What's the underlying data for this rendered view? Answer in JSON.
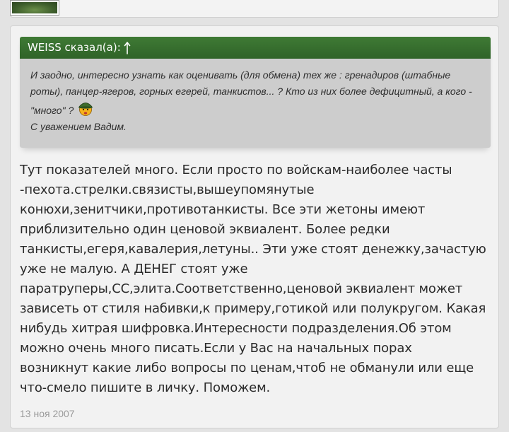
{
  "quote": {
    "author_header": "WEISS сказал(а):",
    "lines": [
      "И заодно, интересно узнать как оценивать (для обмена) тех же : гренадиров (штабные",
      "роты), панцер-ягеров, горных егерей, танкистов... ? Кто из них более дефицитный, а кого -",
      "\"много\" ?",
      "С уважением Вадим."
    ],
    "smiley_icon": "soldier-smiley-icon"
  },
  "message": {
    "lines": [
      "Тут показателей много. Если просто по войскам-наиболее часты",
      "-пехота.стрелки.связисты,вышеупомянутые",
      "конюхи,зенитчики,противотанкисты. Все эти жетоны имеют",
      "приблизительно один ценовой эквиалент. Более редки",
      "танкисты,егеря,кавалерия,летуны.. Эти уже стоят денежку,зачастую",
      "уже не малую. А ДЕНЕГ стоят уже",
      "паратруперы,СС,элита.Соответственно,ценовой эквиалент может",
      "зависеть от стиля набивки,к примеру,готикой или полукругом. Какая",
      "нибудь хитрая шифровка.Интересности подразделения.Об этом",
      "можно очень много писать.Если у Вас на начальных порах",
      "возникнут какие либо вопросы по ценам,чтоб не обманули или еще",
      "что-смело пишите в личку. Поможем."
    ]
  },
  "post_date": "13 ноя 2007",
  "colors": {
    "quote_header": "#2f6328",
    "quote_body": "#cdcdcd",
    "page_bg": "#e3e3e3"
  }
}
